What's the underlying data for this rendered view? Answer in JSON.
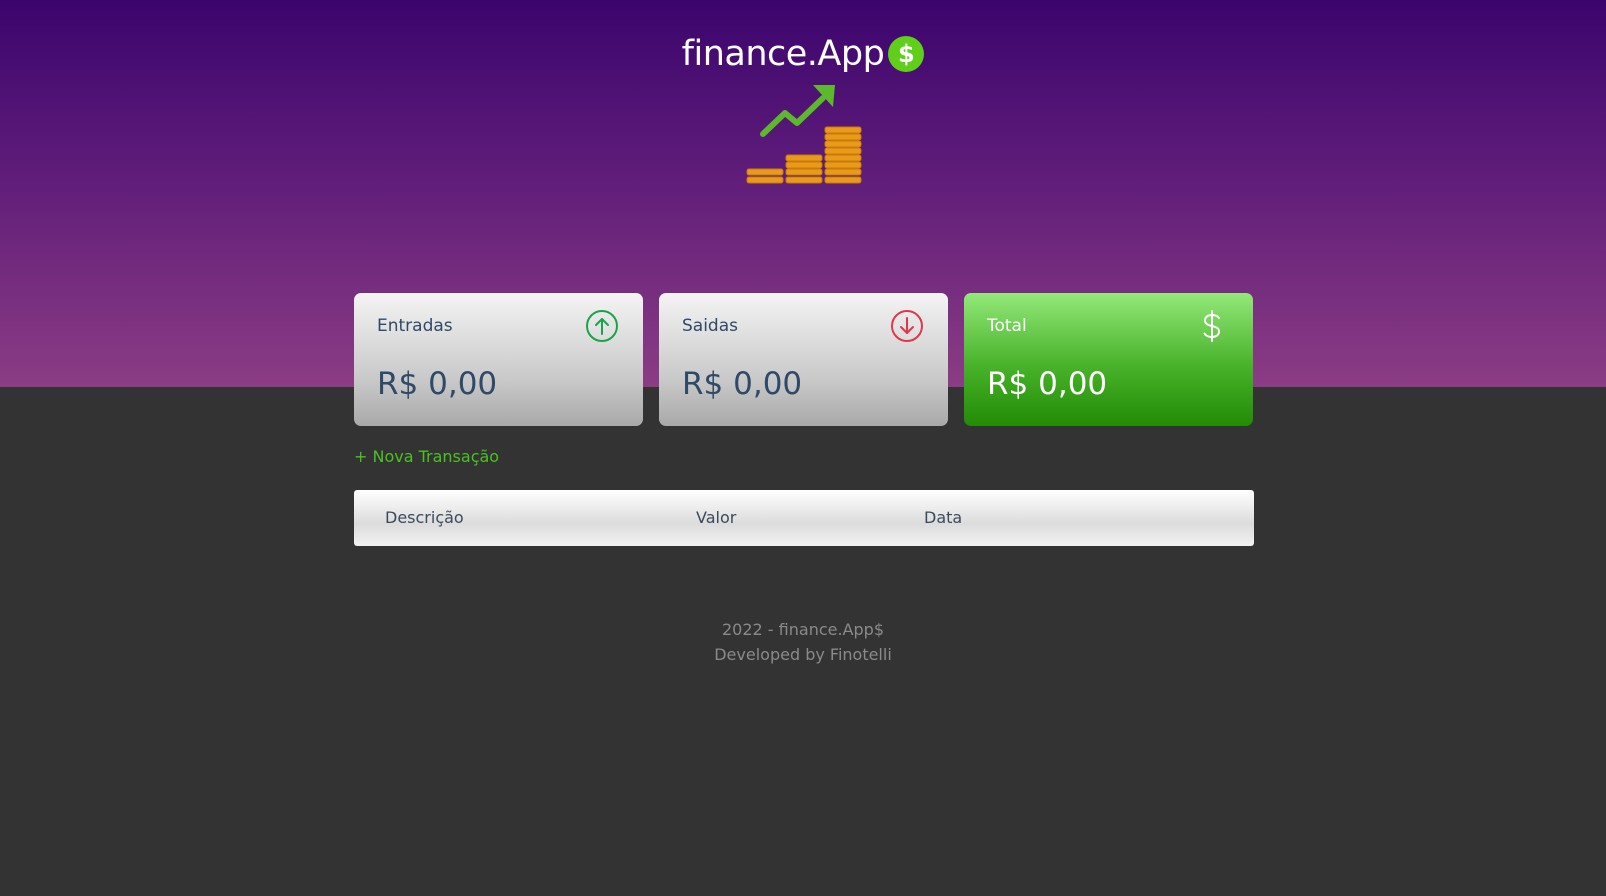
{
  "header": {
    "brand_text": "finance.App",
    "brand_symbol": "$",
    "logo_icon": "chart-coins-icon"
  },
  "cards": [
    {
      "title": "Entradas",
      "value": "R$ 0,00",
      "icon": "arrow-up-circle-icon",
      "color": "#1aa34a"
    },
    {
      "title": "Saidas",
      "value": "R$ 0,00",
      "icon": "arrow-down-circle-icon",
      "color": "#e0374a"
    },
    {
      "title": "Total",
      "value": "R$ 0,00",
      "icon": "dollar-icon",
      "color": "#ffffff"
    }
  ],
  "actions": {
    "new_transaction": "+ Nova Transação"
  },
  "table": {
    "columns": [
      "Descrição",
      "Valor",
      "Data"
    ]
  },
  "footer": {
    "line1": "2022 - finance.App$",
    "line2": "Developed by Finotelli"
  }
}
